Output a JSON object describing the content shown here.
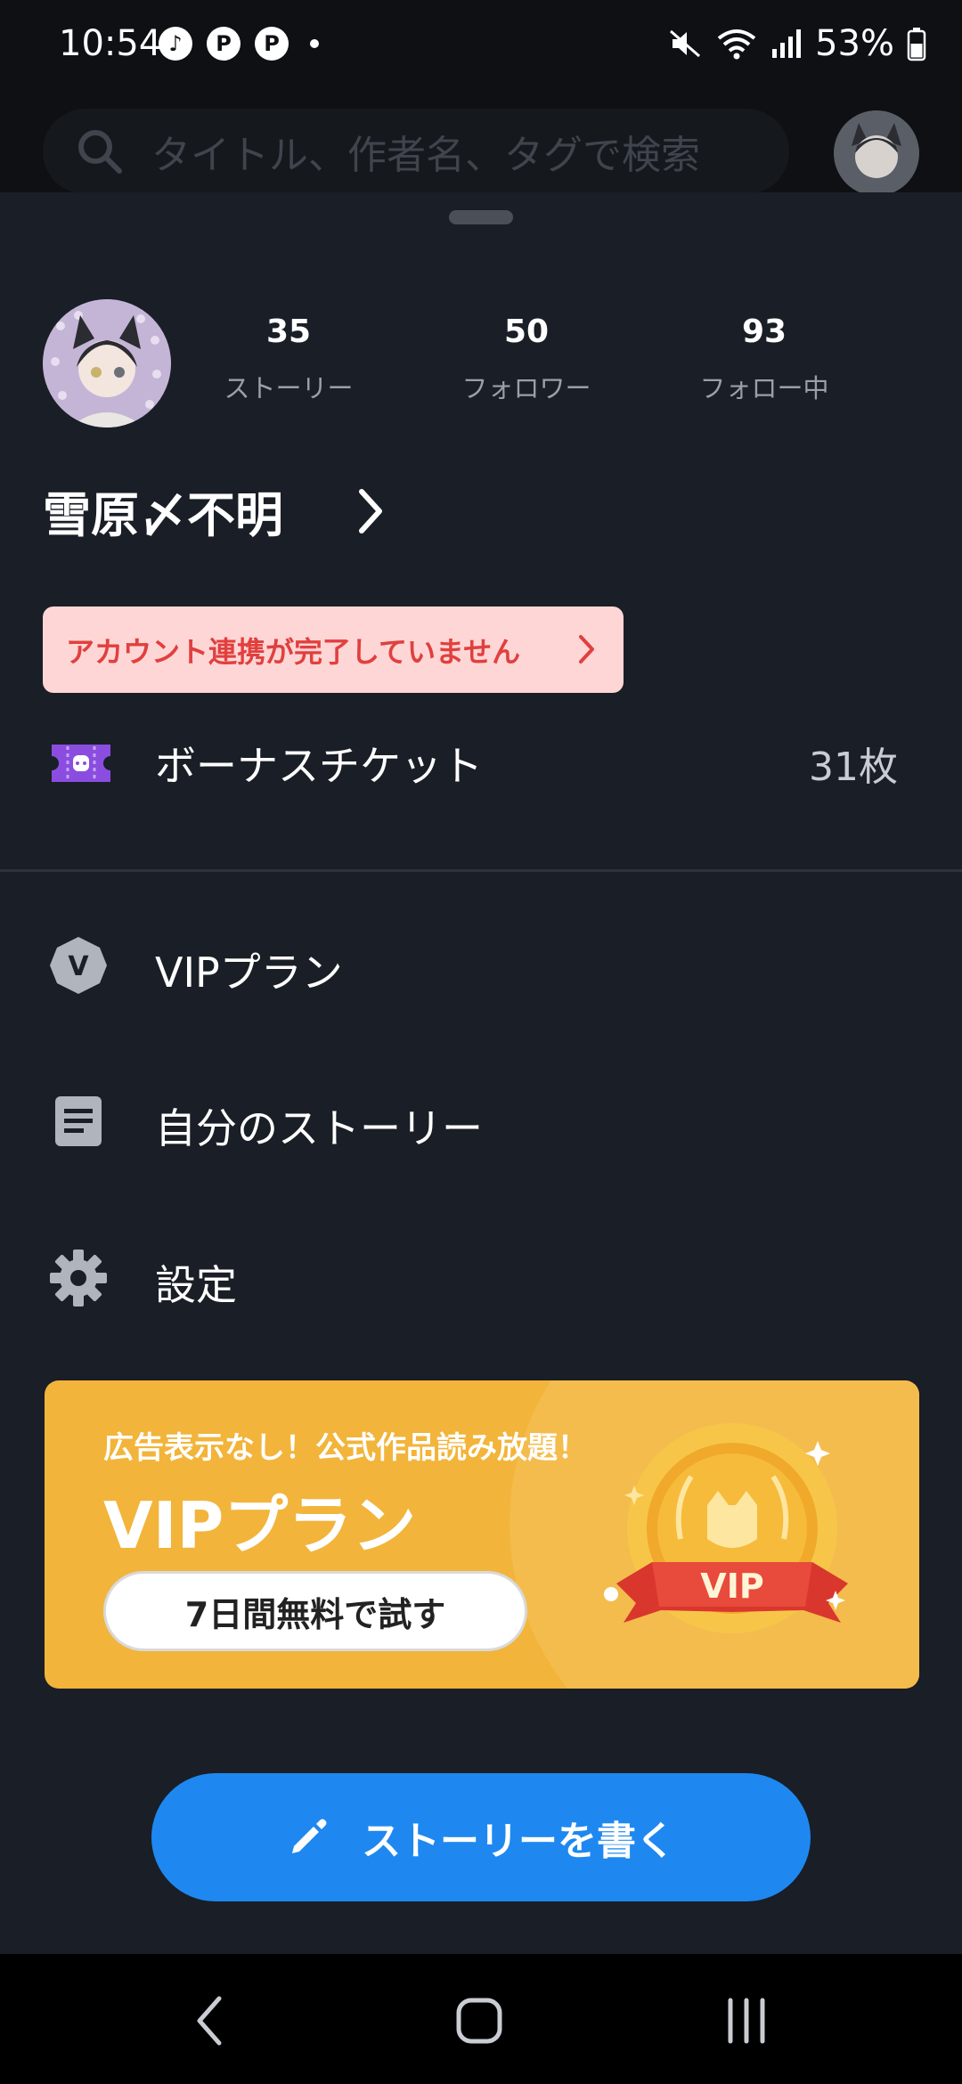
{
  "status_bar": {
    "time": "10:54",
    "left_icons": [
      "music-app-icon",
      "p-app-icon",
      "p-app-icon",
      "dot-icon"
    ],
    "right_icons": [
      "mute-icon",
      "wifi-icon",
      "signal-icon",
      "battery-icon"
    ],
    "battery": "53%"
  },
  "background_header": {
    "search_placeholder": "タイトル、作者名、タグで検索"
  },
  "profile": {
    "stats": [
      {
        "value": "35",
        "label": "ストーリー"
      },
      {
        "value": "50",
        "label": "フォロワー"
      },
      {
        "value": "93",
        "label": "フォロー中"
      }
    ],
    "username": "雪原〆不明"
  },
  "alert": {
    "text": "アカウント連携が完了していません"
  },
  "bonus_ticket": {
    "label": "ボーナスチケット",
    "count": "31枚"
  },
  "menu": {
    "items": [
      {
        "label": "VIPプラン",
        "icon": "vip-icon"
      },
      {
        "label": "自分のストーリー",
        "icon": "document-icon"
      },
      {
        "label": "設定",
        "icon": "gear-icon"
      }
    ]
  },
  "vip_banner": {
    "tagline": "広告表示なし！公式作品読み放題！",
    "title": "VIPプラン",
    "button": "7日間無料で試す",
    "badge_text": "VIP"
  },
  "write_button": {
    "label": "ストーリーを書く"
  },
  "colors": {
    "sheet_bg": "#1a1e26",
    "accent_blue": "#1e88f0",
    "vip_gold": "#f2b43a",
    "alert_red": "#e0403e",
    "alert_bg": "#ffd6d6"
  }
}
